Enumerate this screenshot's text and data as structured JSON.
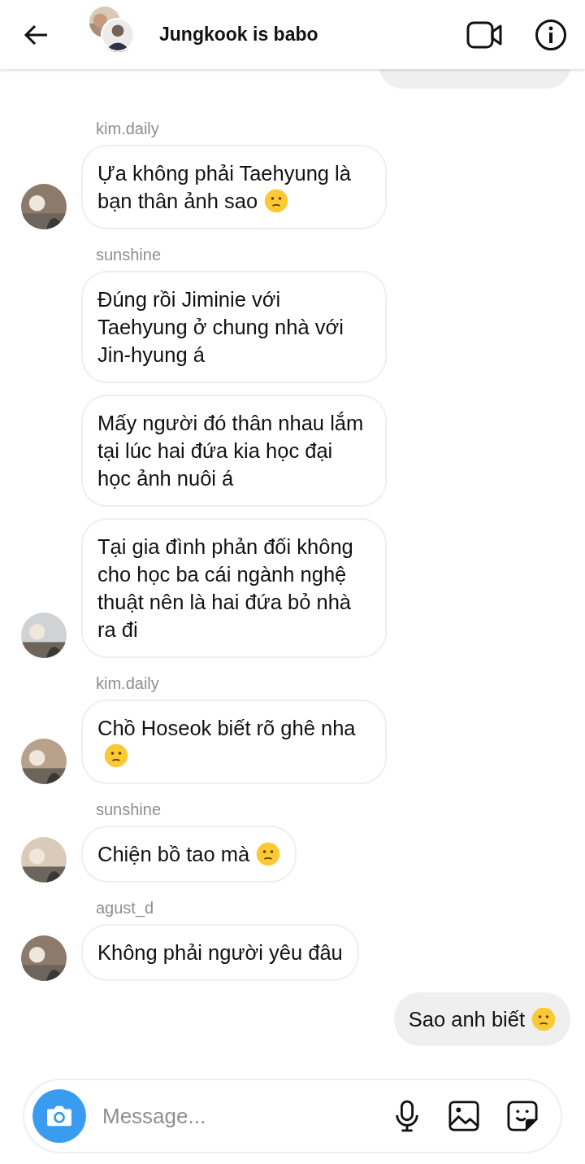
{
  "header": {
    "title": "Jungkook is babo"
  },
  "groups": [
    {
      "outgoing": true,
      "messages": [
        {
          "kind": "plain",
          "avatar": false,
          "partial": true
        }
      ]
    },
    {
      "outgoing": false,
      "sender": "kim.daily",
      "messages": [
        {
          "text": "Ựa không phải Taehyung là bạn thân ảnh sao",
          "kind": "emoji",
          "avatar": true,
          "partial": false
        }
      ]
    },
    {
      "outgoing": false,
      "sender": "sunshine",
      "messages": [
        {
          "text": "Đúng rồi Jiminie với Taehyung ở chung nhà với Jin-hyung á",
          "kind": "plain",
          "avatar": false,
          "partial": false
        },
        {
          "text": "Mấy người đó thân nhau lắm tại lúc hai đứa kia học đại học ảnh nuôi á",
          "kind": "plain",
          "avatar": false,
          "partial": false
        },
        {
          "text": "Tại gia đình phản đối không cho học ba cái ngành nghệ thuật nên là hai đứa bỏ nhà ra đi",
          "kind": "plain",
          "avatar": true,
          "partial": false
        }
      ]
    },
    {
      "outgoing": false,
      "sender": "kim.daily",
      "messages": [
        {
          "text": "Chồ Hoseok biết rõ ghê nha",
          "kind": "emoji",
          "avatar": true,
          "partial": false
        }
      ]
    },
    {
      "outgoing": false,
      "sender": "sunshine",
      "messages": [
        {
          "text": "Chiện bồ tao mà",
          "kind": "emoji",
          "avatar": true,
          "partial": false
        }
      ]
    },
    {
      "outgoing": false,
      "sender": "agust_d",
      "messages": [
        {
          "text": "Không phải người yêu đâu",
          "kind": "plain",
          "avatar": true,
          "partial": false
        }
      ]
    },
    {
      "outgoing": true,
      "messages": [
        {
          "text": "Sao anh biết",
          "kind": "emoji",
          "avatar": false,
          "partial": false
        }
      ]
    }
  ],
  "composer": {
    "placeholder": "Message..."
  }
}
